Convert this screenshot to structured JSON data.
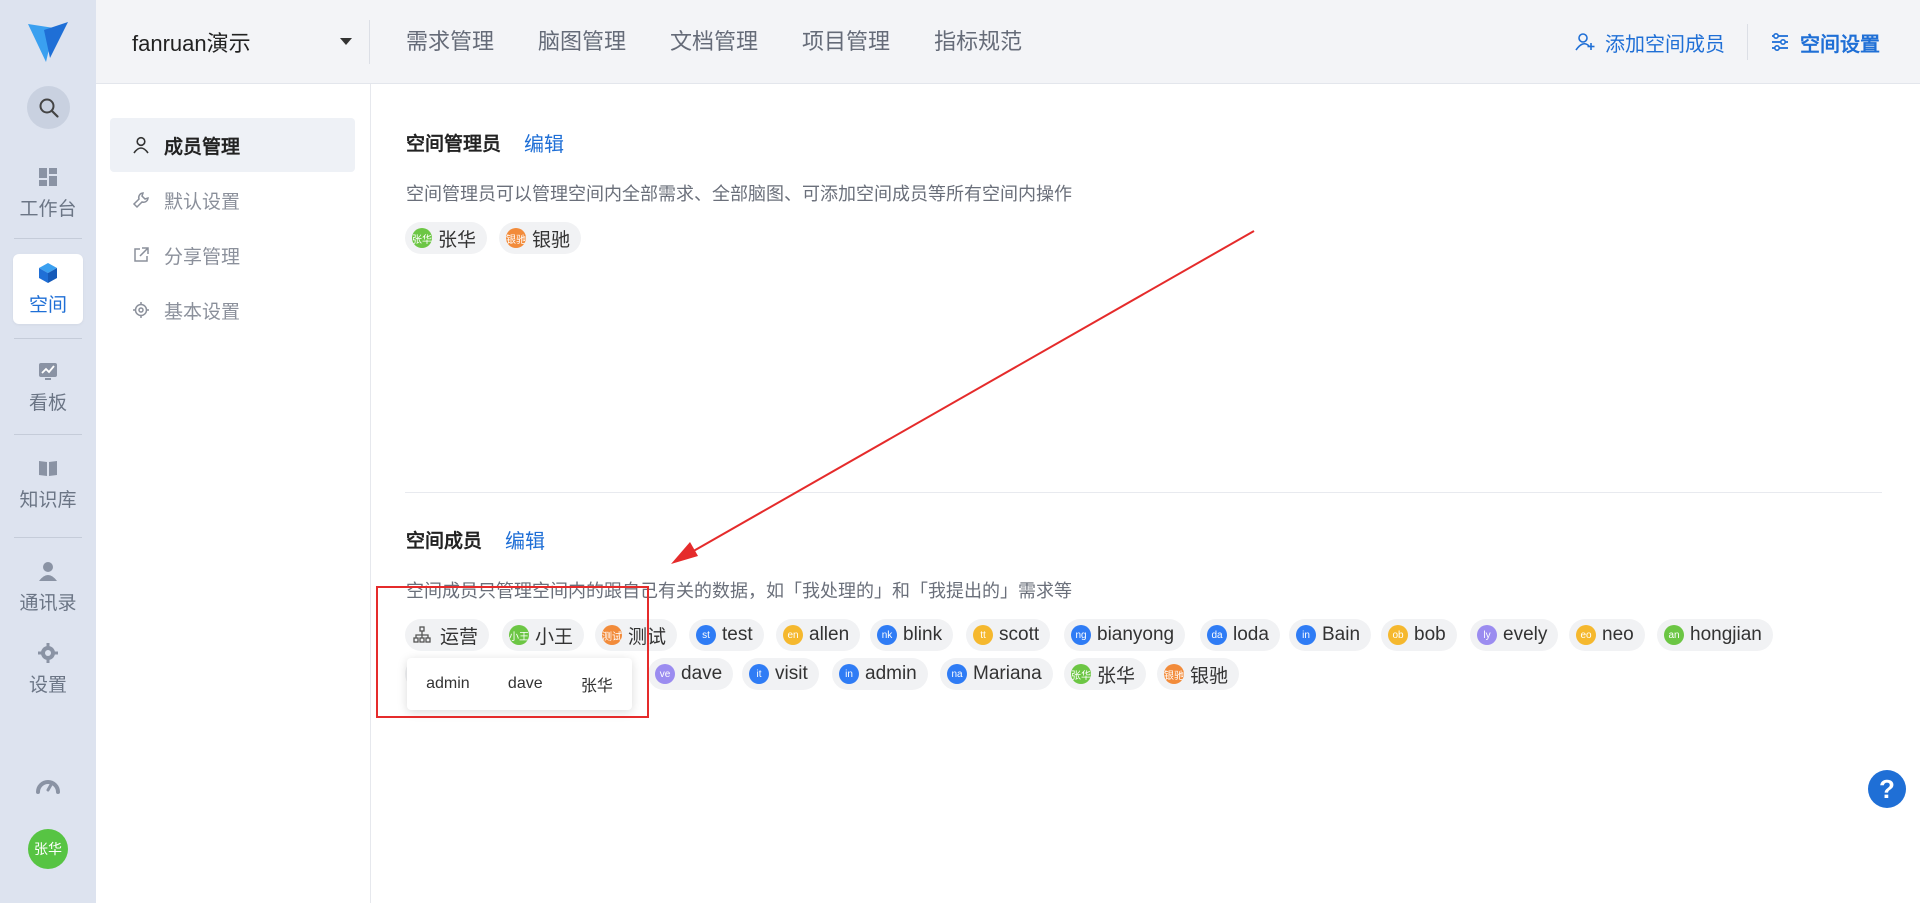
{
  "rail": {
    "items": [
      {
        "label": "工作台",
        "icon": "dashboard-icon"
      },
      {
        "label": "空间",
        "icon": "cube-icon",
        "active": true
      },
      {
        "label": "看板",
        "icon": "chart-board-icon"
      },
      {
        "label": "知识库",
        "icon": "book-icon"
      },
      {
        "label": "通讯录",
        "icon": "contacts-icon"
      },
      {
        "label": "设置",
        "icon": "gear-icon"
      }
    ],
    "avatar": "张华"
  },
  "topbar": {
    "space_name": "fanruan演示",
    "nav": [
      "需求管理",
      "脑图管理",
      "文档管理",
      "项目管理",
      "指标规范"
    ],
    "add_member": "添加空间成员",
    "space_settings": "空间设置"
  },
  "submenu": {
    "items": [
      "成员管理",
      "默认设置",
      "分享管理",
      "基本设置"
    ]
  },
  "admins": {
    "title": "空间管理员",
    "edit": "编辑",
    "desc": "空间管理员可以管理空间内全部需求、全部脑图、可添加空间成员等所有空间内操作",
    "people": [
      {
        "avatar": "张华",
        "name": "张华",
        "color": "green"
      },
      {
        "avatar": "银驰",
        "name": "银驰",
        "color": "orange"
      }
    ]
  },
  "members": {
    "title": "空间成员",
    "edit": "编辑",
    "desc": "空间成员只管理空间内的跟自己有关的数据，如「我处理的」和「我提出的」需求等",
    "group_chip": "运营",
    "row1": [
      {
        "avatar": "小王",
        "name": "小王",
        "color": "green"
      },
      {
        "avatar": "测试",
        "name": "测试",
        "color": "orange"
      },
      {
        "avatar": "st",
        "name": "test",
        "color": "blue"
      },
      {
        "avatar": "en",
        "name": "allen",
        "color": "yellow"
      },
      {
        "avatar": "nk",
        "name": "blink",
        "color": "blue"
      },
      {
        "avatar": "tt",
        "name": "scott",
        "color": "yellow"
      },
      {
        "avatar": "ng",
        "name": "bianyong",
        "color": "blue"
      },
      {
        "avatar": "da",
        "name": "loda",
        "color": "blue"
      },
      {
        "avatar": "in",
        "name": "Bain",
        "color": "blue"
      },
      {
        "avatar": "ob",
        "name": "bob",
        "color": "yellow"
      },
      {
        "avatar": "ly",
        "name": "evely",
        "color": "purple"
      },
      {
        "avatar": "eo",
        "name": "neo",
        "color": "yellow"
      },
      {
        "avatar": "an",
        "name": "hongjian",
        "color": "green"
      }
    ],
    "row2": [
      {
        "avatar": "ve",
        "name": "dave",
        "color": "purple"
      },
      {
        "avatar": "it",
        "name": "visit",
        "color": "blue"
      },
      {
        "avatar": "in",
        "name": "admin",
        "color": "blue"
      },
      {
        "avatar": "na",
        "name": "Mariana",
        "color": "blue"
      },
      {
        "avatar": "张华",
        "name": "张华",
        "color": "green"
      },
      {
        "avatar": "银驰",
        "name": "银驰",
        "color": "orange"
      }
    ],
    "tooltip": [
      "admin",
      "dave",
      "张华"
    ]
  },
  "help_label": "?",
  "colors": {
    "accent": "#1f6fd6",
    "annotation": "#e52b2b"
  }
}
